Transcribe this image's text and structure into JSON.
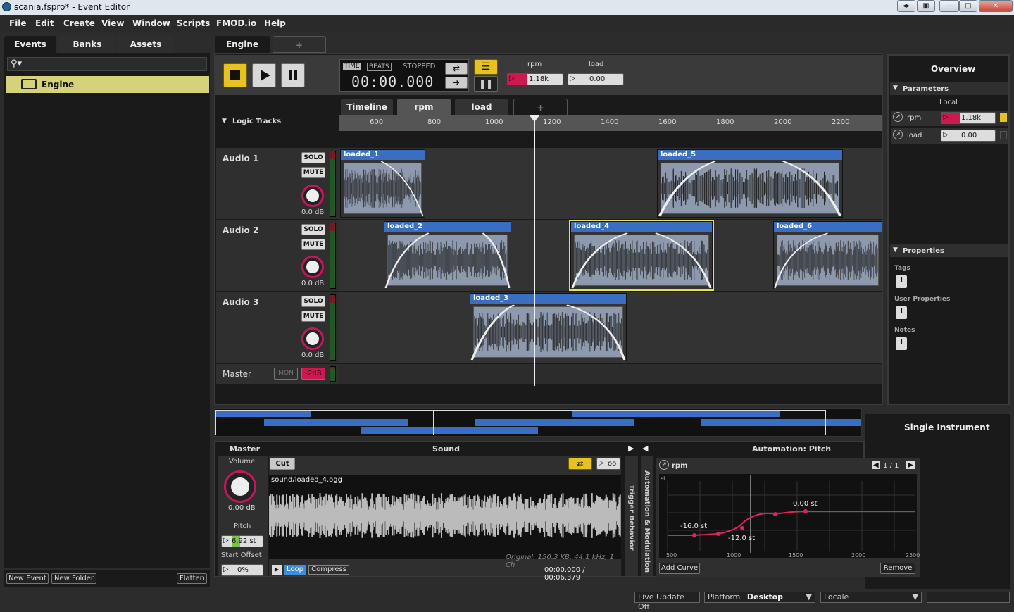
{
  "window": {
    "title": "scania.fspro* - Event Editor"
  },
  "menu": [
    "File",
    "Edit",
    "Create",
    "View",
    "Window",
    "Scripts",
    "FMOD.io",
    "Help"
  ],
  "browser": {
    "tabs": [
      "Events",
      "Banks",
      "Assets"
    ],
    "search_placeholder": "",
    "items": [
      {
        "label": "Engine"
      }
    ],
    "footer": {
      "new_event": "New Event",
      "new_folder": "New Folder",
      "flatten": "Flatten"
    }
  },
  "editor": {
    "tab": "Engine",
    "add_tab": "+",
    "transport": {
      "time_label": "TIME",
      "beats_label": "BEATS",
      "state": "STOPPED",
      "time": "00:00.000"
    },
    "params": [
      {
        "name": "rpm",
        "value": "1.18k"
      },
      {
        "name": "load",
        "value": "0.00"
      }
    ],
    "subtabs": [
      "Timeline",
      "rpm",
      "load",
      "+"
    ],
    "logic_tracks": "Logic Tracks",
    "ruler": [
      "600",
      "800",
      "1000",
      "1200",
      "1400",
      "1600",
      "1800",
      "2000",
      "2200"
    ],
    "tracks": [
      {
        "name": "Audio 1",
        "solo": "SOLO",
        "mute": "MUTE",
        "db": "0.0 dB"
      },
      {
        "name": "Audio 2",
        "solo": "SOLO",
        "mute": "MUTE",
        "db": "0.0 dB"
      },
      {
        "name": "Audio 3",
        "solo": "SOLO",
        "mute": "MUTE",
        "db": "0.0 dB"
      }
    ],
    "master": {
      "name": "Master",
      "mon": "MON",
      "val": "-2dB"
    },
    "instruments": [
      "loaded_1",
      "loaded_5",
      "loaded_2",
      "loaded_4",
      "loaded_6",
      "loaded_3"
    ]
  },
  "overview": {
    "title": "Overview",
    "parameters": "Parameters",
    "local": "Local",
    "params": [
      {
        "name": "rpm",
        "value": "1.18k"
      },
      {
        "name": "load",
        "value": "0.00"
      }
    ],
    "properties": "Properties",
    "tags": "Tags",
    "user_properties": "User Properties",
    "notes": "Notes",
    "single_instrument": "Single Instrument"
  },
  "deck": {
    "master": "Master",
    "volume": "Volume",
    "volume_val": "0.00 dB",
    "pitch": "Pitch",
    "pitch_val": "6.92 st",
    "start_offset": "Start Offset",
    "offset_val": "0%",
    "sound": "Sound",
    "cut": "Cut",
    "loop_count": "oo",
    "file": "sound/loaded_4.ogg",
    "info": "Original: 150.3 KB, 44.1 kHz, 1 Ch",
    "loop": "Loop",
    "compress": "Compress",
    "time": "00:00.000 / 00:06.379",
    "trigger": "Trigger Behavior",
    "automod": "Automation & Modulation",
    "automation_title": "Automation: Pitch",
    "auto_param": "rpm",
    "page": "1 / 1",
    "unit": "st",
    "points": [
      "-16.0 st",
      "-12.0 st",
      "0.00 st"
    ],
    "xticks": [
      "500",
      "1000",
      "1500",
      "2000",
      "2500"
    ],
    "add_curve": "Add Curve",
    "remove": "Remove"
  },
  "statusbar": {
    "live_update": "Live Update Off",
    "platform_label": "Platform",
    "platform": "Desktop",
    "locale": "Locale"
  },
  "colors": {
    "accent": "#e8c320",
    "instrument": "#3a6ec2",
    "param": "#d01850",
    "curve": "#e0245a"
  }
}
